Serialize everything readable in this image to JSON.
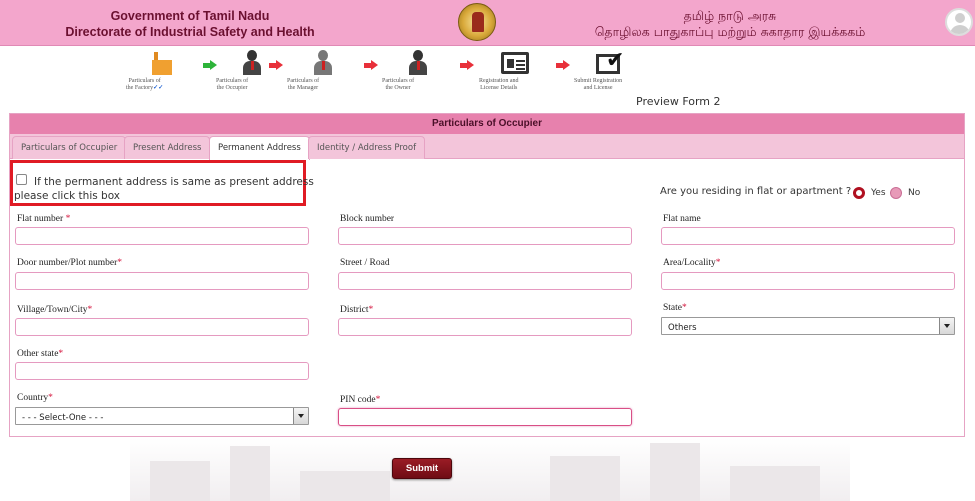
{
  "header": {
    "left_line1": "Government of Tamil Nadu",
    "left_line2": "Directorate of Industrial Safety and Health",
    "right_line1": "தமிழ் நாடு அரசு",
    "right_line2": "தொழிலக பாதுகாப்பு மற்றும் சுகாதார இயக்ககம்"
  },
  "steps": [
    {
      "label_line1": "Particulars of",
      "label_line2": "the Factory",
      "check": "✓✓",
      "icon": "factory-icon"
    },
    {
      "label_line1": "Particulars of",
      "label_line2": "the Occupier",
      "icon": "person-icon"
    },
    {
      "label_line1": "Particulars of",
      "label_line2": "the Manager",
      "icon": "person-icon"
    },
    {
      "label_line1": "Particulars of",
      "label_line2": "the Owner",
      "icon": "person-icon"
    },
    {
      "label_line1": "Registration and",
      "label_line2": "License Details",
      "icon": "id-card-icon"
    },
    {
      "label_line1": "Submit Registration",
      "label_line2": "and License",
      "icon": "checkbox-tick-icon"
    }
  ],
  "preview_form": "Preview Form 2",
  "panel_title": "Particulars of Occupier",
  "tabs": [
    {
      "label": "Particulars of Occupier"
    },
    {
      "label": "Present Address"
    },
    {
      "label": "Permanent Address"
    },
    {
      "label": "Identity / Address Proof"
    }
  ],
  "same_address_text": "If the permanent address is same as present address please click this box",
  "flat_question": "Are you residing in flat or apartment ?",
  "radio_yes": "Yes",
  "radio_no": "No",
  "fields": {
    "flat_number": {
      "label": "Flat number ",
      "req": "*"
    },
    "block_number": {
      "label": "Block number",
      "req": ""
    },
    "flat_name": {
      "label": "Flat name",
      "req": ""
    },
    "door_number": {
      "label": "Door number/Plot number",
      "req": "*"
    },
    "street": {
      "label": "Street / Road",
      "req": ""
    },
    "area": {
      "label": "Area/Locality",
      "req": "*"
    },
    "village": {
      "label": "Village/Town/City",
      "req": "*"
    },
    "district": {
      "label": "District",
      "req": "*"
    },
    "state": {
      "label": "State",
      "req": "*",
      "value": "Others"
    },
    "other_state": {
      "label": "Other state",
      "req": "*"
    },
    "country": {
      "label": "Country",
      "req": "*",
      "value": "- - - Select-One - - -"
    },
    "pin_code": {
      "label": "PIN code",
      "req": "*"
    }
  },
  "submit_label": "Submit"
}
